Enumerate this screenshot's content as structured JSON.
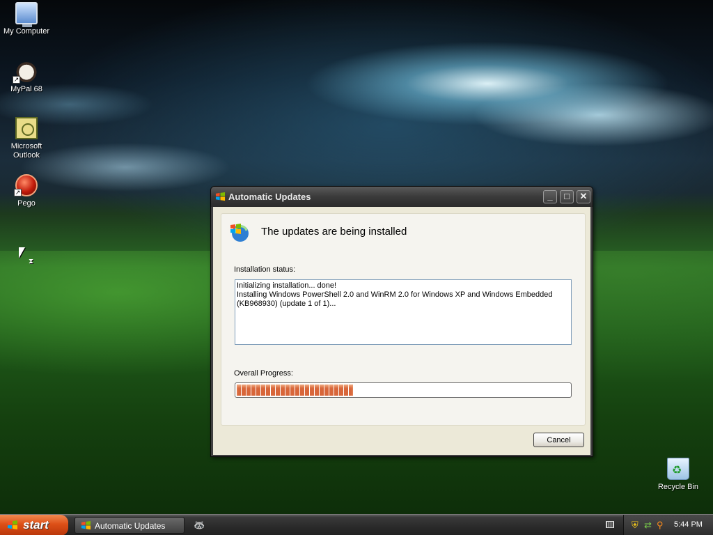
{
  "desktop": {
    "icons": [
      {
        "label": "My Computer",
        "icon": "my-computer-icon"
      },
      {
        "label": "MyPal 68",
        "icon": "mypal-browser-icon"
      },
      {
        "label": "Microsoft Outlook",
        "icon": "outlook-icon"
      },
      {
        "label": "Pego",
        "icon": "pego-icon"
      },
      {
        "label": "Recycle Bin",
        "icon": "recycle-bin-icon"
      }
    ]
  },
  "window": {
    "title": "Automatic Updates",
    "heading": "The updates are being installed",
    "status_label": "Installation status:",
    "status_lines": [
      "Initializing installation... done!",
      "Installing Windows PowerShell 2.0 and WinRM 2.0 for Windows XP and Windows Embedded (KB968930) (update 1 of 1)..."
    ],
    "progress_label": "Overall Progress:",
    "progress_percent": 35,
    "cancel_label": "Cancel",
    "controls": {
      "minimize": "_",
      "maximize": "□",
      "close": "✕"
    }
  },
  "taskbar": {
    "start_label": "start",
    "task_item": "Automatic Updates",
    "clock": "5:44 PM"
  },
  "colors": {
    "progress_fill": "#d8663a",
    "start_button": "#dd4f17",
    "window_frame": "#404040"
  }
}
